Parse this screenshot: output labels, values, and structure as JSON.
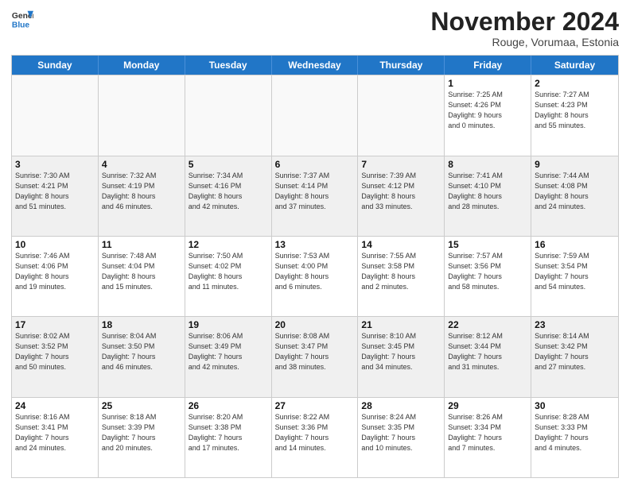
{
  "header": {
    "logo_general": "General",
    "logo_blue": "Blue",
    "month_title": "November 2024",
    "subtitle": "Rouge, Vorumaa, Estonia"
  },
  "weekdays": [
    "Sunday",
    "Monday",
    "Tuesday",
    "Wednesday",
    "Thursday",
    "Friday",
    "Saturday"
  ],
  "weeks": [
    [
      {
        "day": "",
        "info": ""
      },
      {
        "day": "",
        "info": ""
      },
      {
        "day": "",
        "info": ""
      },
      {
        "day": "",
        "info": ""
      },
      {
        "day": "",
        "info": ""
      },
      {
        "day": "1",
        "info": "Sunrise: 7:25 AM\nSunset: 4:26 PM\nDaylight: 9 hours\nand 0 minutes."
      },
      {
        "day": "2",
        "info": "Sunrise: 7:27 AM\nSunset: 4:23 PM\nDaylight: 8 hours\nand 55 minutes."
      }
    ],
    [
      {
        "day": "3",
        "info": "Sunrise: 7:30 AM\nSunset: 4:21 PM\nDaylight: 8 hours\nand 51 minutes."
      },
      {
        "day": "4",
        "info": "Sunrise: 7:32 AM\nSunset: 4:19 PM\nDaylight: 8 hours\nand 46 minutes."
      },
      {
        "day": "5",
        "info": "Sunrise: 7:34 AM\nSunset: 4:16 PM\nDaylight: 8 hours\nand 42 minutes."
      },
      {
        "day": "6",
        "info": "Sunrise: 7:37 AM\nSunset: 4:14 PM\nDaylight: 8 hours\nand 37 minutes."
      },
      {
        "day": "7",
        "info": "Sunrise: 7:39 AM\nSunset: 4:12 PM\nDaylight: 8 hours\nand 33 minutes."
      },
      {
        "day": "8",
        "info": "Sunrise: 7:41 AM\nSunset: 4:10 PM\nDaylight: 8 hours\nand 28 minutes."
      },
      {
        "day": "9",
        "info": "Sunrise: 7:44 AM\nSunset: 4:08 PM\nDaylight: 8 hours\nand 24 minutes."
      }
    ],
    [
      {
        "day": "10",
        "info": "Sunrise: 7:46 AM\nSunset: 4:06 PM\nDaylight: 8 hours\nand 19 minutes."
      },
      {
        "day": "11",
        "info": "Sunrise: 7:48 AM\nSunset: 4:04 PM\nDaylight: 8 hours\nand 15 minutes."
      },
      {
        "day": "12",
        "info": "Sunrise: 7:50 AM\nSunset: 4:02 PM\nDaylight: 8 hours\nand 11 minutes."
      },
      {
        "day": "13",
        "info": "Sunrise: 7:53 AM\nSunset: 4:00 PM\nDaylight: 8 hours\nand 6 minutes."
      },
      {
        "day": "14",
        "info": "Sunrise: 7:55 AM\nSunset: 3:58 PM\nDaylight: 8 hours\nand 2 minutes."
      },
      {
        "day": "15",
        "info": "Sunrise: 7:57 AM\nSunset: 3:56 PM\nDaylight: 7 hours\nand 58 minutes."
      },
      {
        "day": "16",
        "info": "Sunrise: 7:59 AM\nSunset: 3:54 PM\nDaylight: 7 hours\nand 54 minutes."
      }
    ],
    [
      {
        "day": "17",
        "info": "Sunrise: 8:02 AM\nSunset: 3:52 PM\nDaylight: 7 hours\nand 50 minutes."
      },
      {
        "day": "18",
        "info": "Sunrise: 8:04 AM\nSunset: 3:50 PM\nDaylight: 7 hours\nand 46 minutes."
      },
      {
        "day": "19",
        "info": "Sunrise: 8:06 AM\nSunset: 3:49 PM\nDaylight: 7 hours\nand 42 minutes."
      },
      {
        "day": "20",
        "info": "Sunrise: 8:08 AM\nSunset: 3:47 PM\nDaylight: 7 hours\nand 38 minutes."
      },
      {
        "day": "21",
        "info": "Sunrise: 8:10 AM\nSunset: 3:45 PM\nDaylight: 7 hours\nand 34 minutes."
      },
      {
        "day": "22",
        "info": "Sunrise: 8:12 AM\nSunset: 3:44 PM\nDaylight: 7 hours\nand 31 minutes."
      },
      {
        "day": "23",
        "info": "Sunrise: 8:14 AM\nSunset: 3:42 PM\nDaylight: 7 hours\nand 27 minutes."
      }
    ],
    [
      {
        "day": "24",
        "info": "Sunrise: 8:16 AM\nSunset: 3:41 PM\nDaylight: 7 hours\nand 24 minutes."
      },
      {
        "day": "25",
        "info": "Sunrise: 8:18 AM\nSunset: 3:39 PM\nDaylight: 7 hours\nand 20 minutes."
      },
      {
        "day": "26",
        "info": "Sunrise: 8:20 AM\nSunset: 3:38 PM\nDaylight: 7 hours\nand 17 minutes."
      },
      {
        "day": "27",
        "info": "Sunrise: 8:22 AM\nSunset: 3:36 PM\nDaylight: 7 hours\nand 14 minutes."
      },
      {
        "day": "28",
        "info": "Sunrise: 8:24 AM\nSunset: 3:35 PM\nDaylight: 7 hours\nand 10 minutes."
      },
      {
        "day": "29",
        "info": "Sunrise: 8:26 AM\nSunset: 3:34 PM\nDaylight: 7 hours\nand 7 minutes."
      },
      {
        "day": "30",
        "info": "Sunrise: 8:28 AM\nSunset: 3:33 PM\nDaylight: 7 hours\nand 4 minutes."
      }
    ]
  ]
}
